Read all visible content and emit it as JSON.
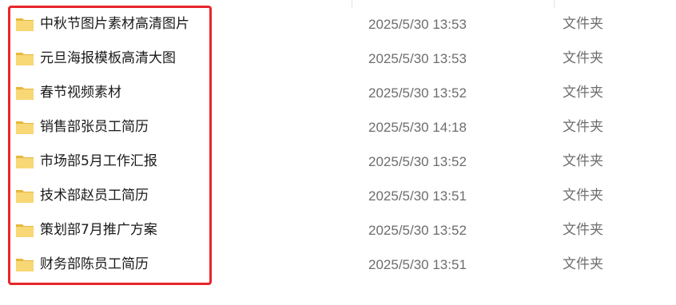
{
  "files": [
    {
      "name": "中秋节图片素材高清图片",
      "modified": "2025/5/30 13:53",
      "type": "文件夹",
      "icon": "folder-icon"
    },
    {
      "name": "元旦海报模板高清大图",
      "modified": "2025/5/30 13:53",
      "type": "文件夹",
      "icon": "folder-icon"
    },
    {
      "name": "春节视频素材",
      "modified": "2025/5/30 13:52",
      "type": "文件夹",
      "icon": "folder-icon"
    },
    {
      "name": "销售部张员工简历",
      "modified": "2025/5/30 14:18",
      "type": "文件夹",
      "icon": "folder-icon"
    },
    {
      "name": "市场部5月工作汇报",
      "modified": "2025/5/30 13:52",
      "type": "文件夹",
      "icon": "folder-icon"
    },
    {
      "name": "技术部赵员工简历",
      "modified": "2025/5/30 13:51",
      "type": "文件夹",
      "icon": "folder-icon"
    },
    {
      "name": "策划部7月推广方案",
      "modified": "2025/5/30 13:52",
      "type": "文件夹",
      "icon": "folder-icon"
    },
    {
      "name": "财务部陈员工简历",
      "modified": "2025/5/30 13:51",
      "type": "文件夹",
      "icon": "folder-icon"
    }
  ],
  "colors": {
    "highlight_border": "#e8262b",
    "folder_fill": "#f8d775",
    "folder_back": "#e7b73c",
    "secondary_text": "#6d6d6d"
  }
}
